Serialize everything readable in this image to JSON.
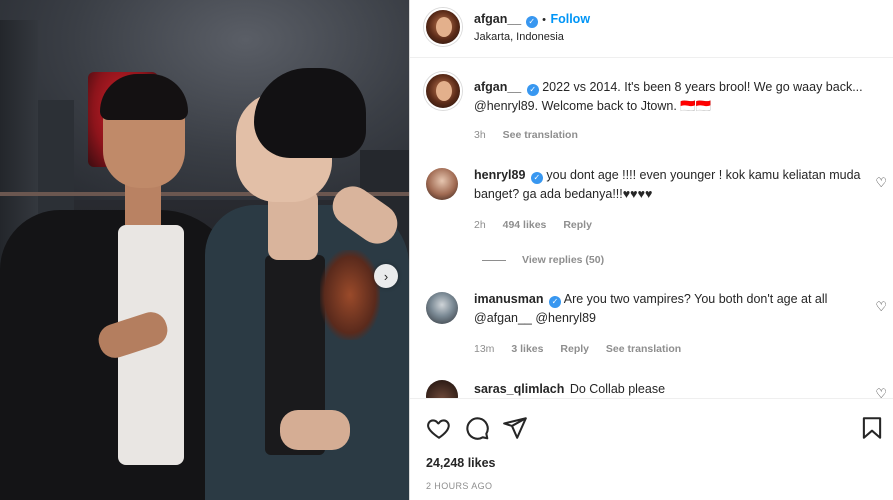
{
  "post": {
    "author": "afgan__",
    "follow_label": "Follow",
    "separator": "•",
    "location": "Jakarta, Indonesia",
    "caption": "2022 vs 2014. It's been 8 years brool! We go waay back... @henryl89. Welcome back to Jtown. 🇮🇩🇮🇩",
    "caption_meta": {
      "time": "3h",
      "see_translation": "See translation"
    },
    "likes": "24,248 likes",
    "timestamp": "2 HOURS AGO",
    "photo_next_icon": "chevron-right-icon"
  },
  "comments": [
    {
      "user": "henryl89",
      "verified": true,
      "text": "you dont age !!!! even younger ! kok kamu keliatan muda banget? ga ada bedanya!!!♥♥♥♥",
      "time": "2h",
      "likes": "494 likes",
      "reply": "Reply",
      "view_replies": "View replies (50)"
    },
    {
      "user": "imanusman",
      "verified": true,
      "text": "Are you two vampires? You both don't age at all @afgan__ @henryl89",
      "time": "13m",
      "likes": "3 likes",
      "reply": "Reply",
      "see_translation": "See translation"
    },
    {
      "user": "saras_qlimlach",
      "verified": false,
      "text": "Do Collab please"
    }
  ],
  "icons": {
    "like": "heart-icon",
    "comment": "comment-icon",
    "share": "paper-plane-icon",
    "save": "bookmark-icon",
    "comment_like": "heart-outline-icon"
  },
  "colors": {
    "link": "#0095f6",
    "verified": "#3897f0",
    "muted": "#8e8e8e"
  }
}
